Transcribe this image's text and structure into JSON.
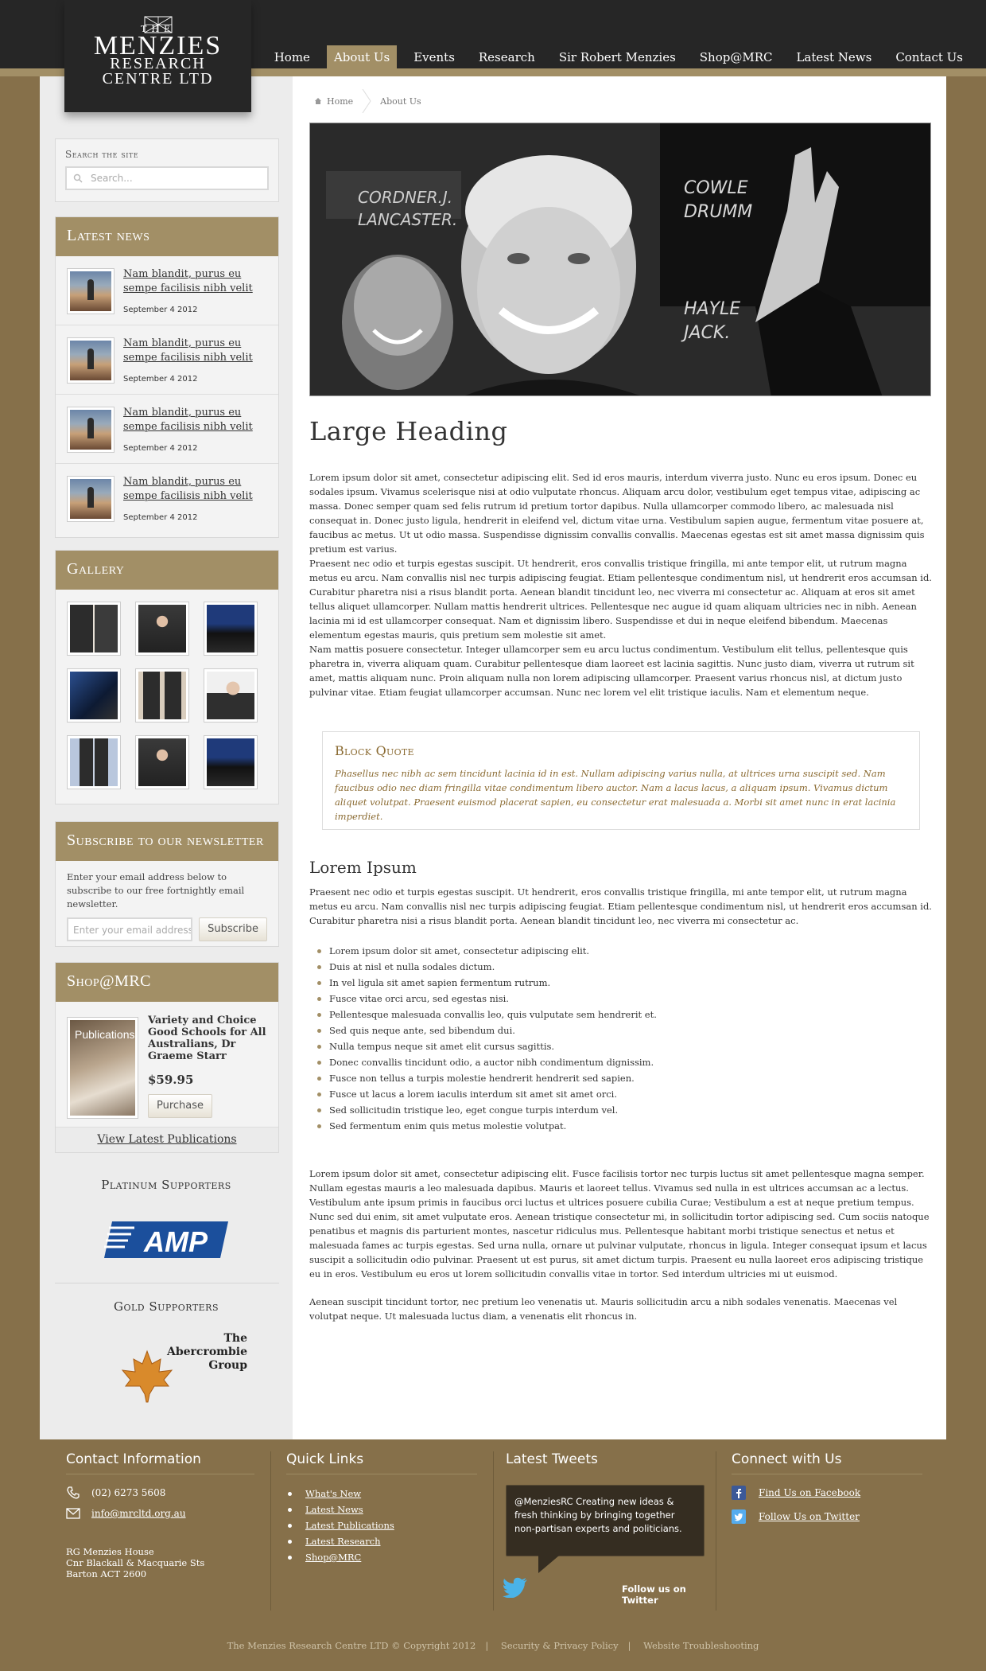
{
  "logo": {
    "line1": "THE",
    "line2": "MENZIES",
    "line3": "RESEARCH",
    "line4": "CENTRE LTD"
  },
  "nav": {
    "items": [
      "Home",
      "About Us",
      "Events",
      "Research",
      "Sir Robert Menzies",
      "Shop@MRC",
      "Latest News",
      "Contact Us"
    ],
    "active": "About Us"
  },
  "search": {
    "label": "Search the site",
    "placeholder": "Search..."
  },
  "latest_news": {
    "heading": "Latest news",
    "items": [
      {
        "title": "Nam blandit, purus eu sempe facilisis nibh velit",
        "date": "September 4 2012"
      },
      {
        "title": "Nam blandit, purus eu sempe facilisis nibh velit",
        "date": "September 4 2012"
      },
      {
        "title": "Nam blandit, purus eu sempe facilisis nibh velit",
        "date": "September 4 2012"
      },
      {
        "title": "Nam blandit, purus eu sempe facilisis nibh velit",
        "date": "September 4 2012"
      }
    ]
  },
  "gallery": {
    "heading": "Gallery",
    "count": 9
  },
  "newsletter": {
    "heading": "Subscribe to our newsletter",
    "text": "Enter your email address below to subscribe to our free fortnightly email newsletter.",
    "placeholder": "Enter your email address",
    "button": "Subscribe"
  },
  "shop": {
    "heading": "Shop@MRC",
    "book_label": "Publications",
    "title": "Variety and Choice Good Schools for All Australians, Dr Graeme Starr",
    "price": "$59.95",
    "button": "Purchase",
    "link": "View Latest Publications"
  },
  "supporters": {
    "platinum": "Platinum Supporters",
    "amp": "AMP",
    "gold": "Gold Supporters",
    "abercrombie": [
      "The",
      "Abercrombie",
      "Group"
    ]
  },
  "breadcrumb": {
    "home": "Home",
    "current": "About Us"
  },
  "content": {
    "heading": "Large Heading",
    "p1": "Lorem ipsum dolor sit amet, consectetur adipiscing elit. Sed id eros mauris, interdum viverra justo. Nunc eu eros ipsum. Donec eu sodales ipsum. Vivamus scelerisque nisi at odio vulputate rhoncus. Aliquam arcu dolor, vestibulum eget tempus vitae, adipiscing ac massa. Donec semper quam sed felis rutrum id pretium tortor dapibus. Nulla ullamcorper commodo libero, ac malesuada nisl consequat in. Donec justo ligula, hendrerit in eleifend vel, dictum vitae urna. Vestibulum sapien augue, fermentum vitae posuere at, faucibus ac metus. Ut ut odio massa. Suspendisse dignissim convallis convallis. Maecenas egestas est sit amet massa dignissim quis pretium est varius.",
    "p2": "Praesent nec odio et turpis egestas suscipit. Ut hendrerit, eros convallis tristique fringilla, mi ante tempor elit, ut rutrum magna metus eu arcu. Nam convallis nisl nec turpis adipiscing feugiat. Etiam pellentesque condimentum nisl, ut hendrerit eros accumsan id. Curabitur pharetra nisi a risus blandit porta. Aenean blandit tincidunt leo, nec viverra mi consectetur ac. Aliquam at eros sit amet tellus aliquet ullamcorper. Nullam mattis hendrerit ultrices. Pellentesque nec augue id quam aliquam ultricies nec in nibh. Aenean lacinia mi id est ullamcorper consequat. Nam et dignissim libero. Suspendisse et dui in neque eleifend bibendum. Maecenas elementum egestas mauris, quis pretium sem molestie sit amet.",
    "p3": "Nam mattis posuere consectetur. Integer ullamcorper sem eu arcu luctus condimentum. Vestibulum elit tellus, pellentesque quis pharetra in, viverra aliquam quam. Curabitur pellentesque diam laoreet est lacinia sagittis. Nunc justo diam, viverra ut rutrum sit amet, mattis aliquam nunc. Proin aliquam nulla non lorem adipiscing ullamcorper. Praesent varius rhoncus nisl, at dictum justo pulvinar vitae. Etiam feugiat ullamcorper accumsan. Nunc nec lorem vel elit tristique iaculis. Nam et elementum neque.",
    "quote_heading": "Block Quote",
    "quote_text": "Phasellus nec nibh ac sem tincidunt lacinia id in est. Nullam adipiscing varius nulla, at ultrices urna suscipit sed. Nam faucibus odio nec diam fringilla vitae condimentum libero auctor. Nam a lacus lacus, a aliquam ipsum. Vivamus dictum aliquet volutpat. Praesent euismod placerat sapien, eu consectetur erat malesuada a. Morbi sit amet nunc in erat lacinia imperdiet.",
    "subheading": "Lorem Ipsum",
    "p4": "Praesent nec odio et turpis egestas suscipit. Ut hendrerit, eros convallis tristique fringilla, mi ante tempor elit, ut rutrum magna metus eu arcu. Nam convallis nisl nec turpis adipiscing feugiat. Etiam pellentesque condimentum nisl, ut hendrerit eros accumsan id. Curabitur pharetra nisi a risus blandit porta. Aenean blandit tincidunt leo, nec viverra mi consectetur ac.",
    "list": [
      "Lorem ipsum dolor sit amet, consectetur adipiscing elit.",
      "Duis at nisl et nulla sodales dictum.",
      "In vel ligula sit amet sapien fermentum rutrum.",
      "Fusce vitae orci arcu, sed egestas nisi.",
      "Pellentesque malesuada convallis leo, quis vulputate sem hendrerit et.",
      "Sed quis neque ante, sed bibendum dui.",
      "Nulla tempus neque sit amet elit cursus sagittis.",
      "Donec convallis tincidunt odio, a auctor nibh condimentum dignissim.",
      "Fusce non tellus a turpis molestie hendrerit hendrerit sed sapien.",
      "Fusce ut lacus a lorem iaculis interdum sit amet sit amet orci.",
      "Sed sollicitudin tristique leo, eget congue turpis interdum vel.",
      "Sed fermentum enim quis metus molestie volutpat."
    ],
    "p5": "Lorem ipsum dolor sit amet, consectetur adipiscing elit. Fusce facilisis tortor nec turpis luctus sit amet pellentesque magna semper. Nullam egestas mauris a leo malesuada dapibus. Mauris et laoreet tellus. Vivamus sed nulla in est ultrices accumsan ac a lectus. Vestibulum ante ipsum primis in faucibus orci luctus et ultrices posuere cubilia Curae; Vestibulum a est at neque pretium tempus. Nunc sed dui enim, sit amet vulputate eros. Aenean tristique consectetur mi, in sollicitudin tortor adipiscing sed. Cum sociis natoque penatibus et magnis dis parturient montes, nascetur ridiculus mus. Pellentesque habitant morbi tristique senectus et netus et malesuada fames ac turpis egestas. Sed urna nulla, ornare ut pulvinar vulputate, rhoncus in ligula. Integer consequat ipsum et lacus suscipit a sollicitudin odio pulvinar. Praesent ut est purus, sit amet dictum turpis. Praesent eu nulla laoreet eros adipiscing tristique eu in eros. Vestibulum eu eros ut lorem sollicitudin convallis vitae in tortor. Sed interdum ultricies mi ut euismod.",
    "p6": "Aenean suscipit tincidunt tortor, nec pretium leo venenatis ut. Mauris sollicitudin arcu a nibh sodales venenatis. Maecenas vel volutpat neque. Ut malesuada luctus diam, a venenatis elit rhoncus in."
  },
  "footer": {
    "contact_heading": "Contact Information",
    "phone": "(02) 6273 5608",
    "email": "info@mrcltd.org.au",
    "address": [
      "RG Menzies House",
      "Cnr Blackall & Macquarie Sts",
      "Barton ACT 2600"
    ],
    "quick_heading": "Quick Links",
    "quick_links": [
      "What's New",
      "Latest News",
      "Latest Publications",
      "Latest Research",
      "Shop@MRC"
    ],
    "tweets_heading": "Latest Tweets",
    "tweet": "@MenziesRC  Creating new ideas & fresh thinking by bringing together non-partisan experts and politicians.",
    "follow": "Follow us on Twitter",
    "connect_heading": "Connect with Us",
    "facebook": "Find Us on Facebook",
    "twitter": "Follow Us on Twitter",
    "copyright": "The Menzies Research Centre LTD © Copyright 2012",
    "privacy": "Security & Privacy Policy",
    "troubleshooting": "Website Troubleshooting"
  },
  "colors": {
    "dark": "#262626",
    "accent": "#a28f66",
    "footer": "#86704a",
    "quote": "#8a6a31",
    "amp_blue": "#1b4f9c"
  }
}
